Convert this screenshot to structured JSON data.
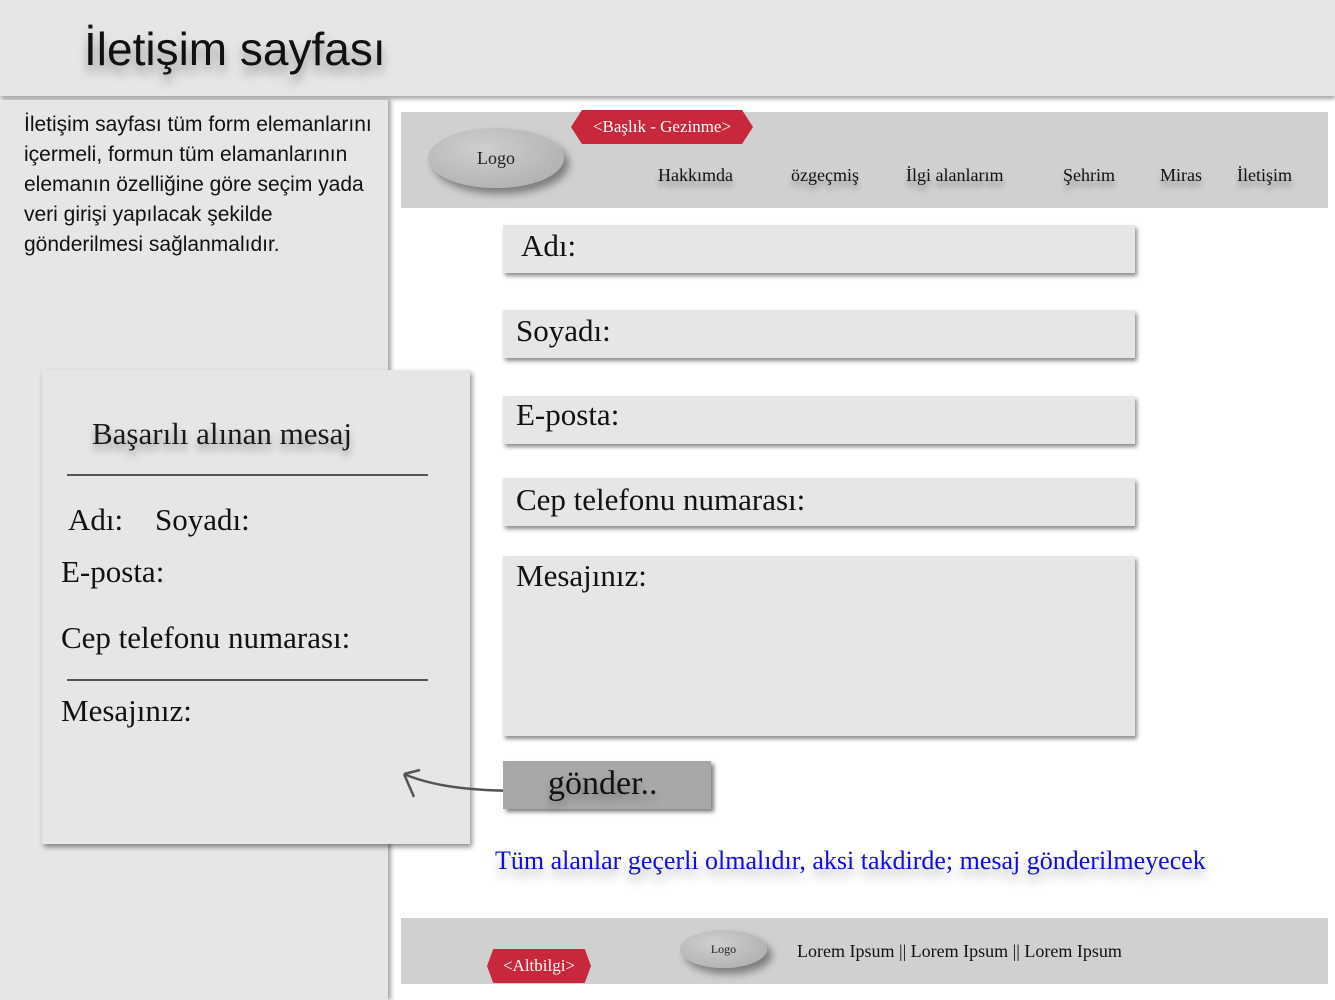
{
  "page": {
    "title": "İletişim sayfası",
    "description": "İletişim sayfası tüm form elemanlarını içermeli, formun tüm elamanlarının elemanın özelliğine göre seçim yada veri girişi yapılacak şekilde gönderilmesi sağlanmalıdır."
  },
  "message_card": {
    "title": "Başarılı alınan mesaj",
    "first_name": "Adı:",
    "last_name": "Soyadı:",
    "email": "E-posta:",
    "phone": "Cep telefonu numarası:",
    "message": "Mesajınız:"
  },
  "header": {
    "tag": "<Başlık - Gezinme>",
    "logo": "Logo",
    "nav": [
      "Hakkımda",
      "özgeçmiş",
      "İlgi alanlarım",
      "Şehrim",
      "Miras",
      "İletişim"
    ]
  },
  "form": {
    "fields": [
      "Adı:",
      "Soyadı:",
      "E-posta:",
      "Cep telefonu numarası:",
      "Mesajınız:"
    ],
    "submit_label": "gönder..",
    "warning": "Tüm alanlar geçerli olmalıdır, aksi takdirde; mesaj gönderilmeyecek"
  },
  "footer": {
    "tag": "<Altbilgi>",
    "logo": "Logo",
    "links": "Lorem Ipsum || Lorem Ipsum || Lorem Ipsum"
  },
  "colors": {
    "accent_tag": "#c8283b",
    "warning_text": "#1010d0",
    "panel_bg": "#e6e6e6",
    "header_bg": "#d0d0d0"
  }
}
